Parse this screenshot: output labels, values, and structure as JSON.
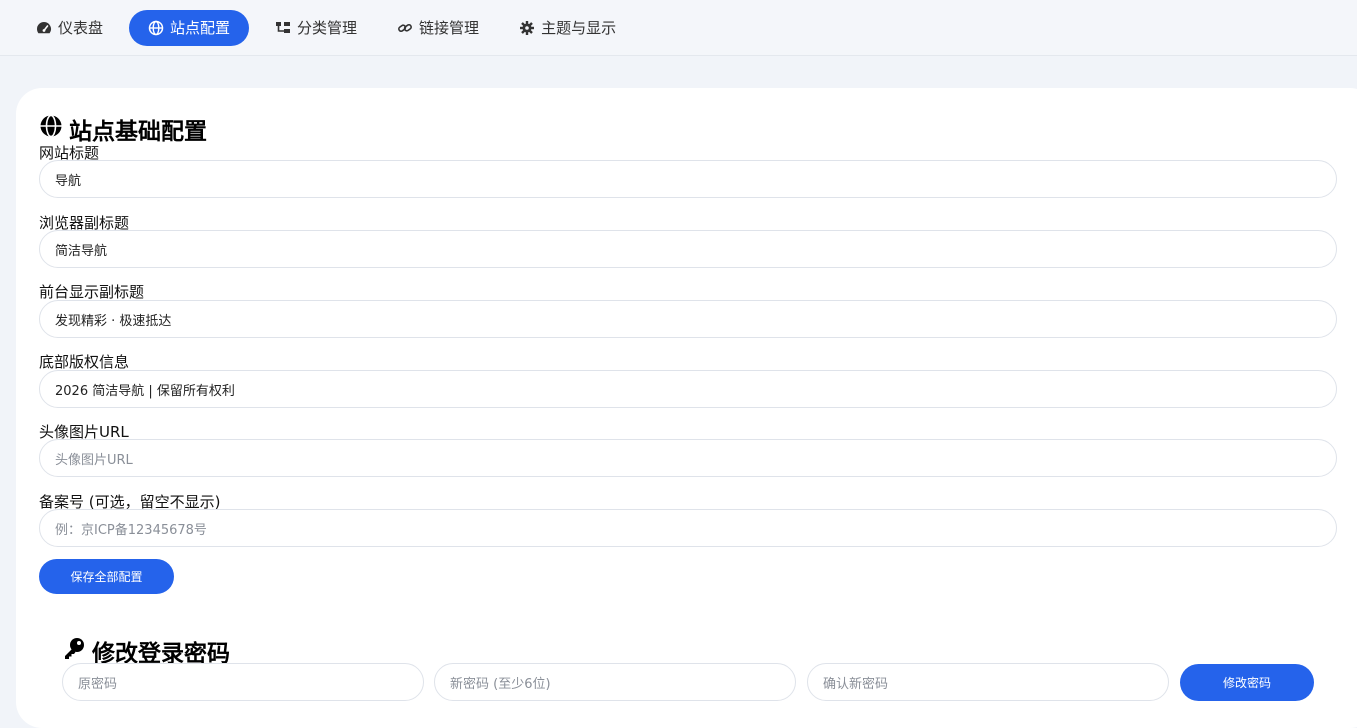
{
  "nav": {
    "tabs": [
      {
        "label": "仪表盘",
        "icon": "gauge-icon"
      },
      {
        "label": "站点配置",
        "icon": "globe-icon",
        "active": true
      },
      {
        "label": "分类管理",
        "icon": "sitemap-icon"
      },
      {
        "label": "链接管理",
        "icon": "link-icon"
      },
      {
        "label": "主题与显示",
        "icon": "gear-icon"
      }
    ]
  },
  "site_config": {
    "title": "站点基础配置",
    "title_icon": "globe-icon",
    "fields": [
      {
        "label": "网站标题",
        "value": "导航",
        "placeholder": ""
      },
      {
        "label": "浏览器副标题",
        "value": "简洁导航",
        "placeholder": ""
      },
      {
        "label": "前台显示副标题",
        "value": "发现精彩 · 极速抵达",
        "placeholder": ""
      },
      {
        "label": "底部版权信息",
        "value": "2026 简洁导航 | 保留所有权利",
        "placeholder": ""
      },
      {
        "label": "头像图片URL",
        "value": "",
        "placeholder": "头像图片URL"
      },
      {
        "label": "备案号 (可选，留空不显示)",
        "value": "",
        "placeholder": "例：京ICP备12345678号"
      }
    ],
    "save_label": "保存全部配置"
  },
  "password": {
    "title": "修改登录密码",
    "title_icon": "key-icon",
    "old_placeholder": "原密码",
    "new_placeholder": "新密码 (至少6位)",
    "confirm_placeholder": "确认新密码",
    "submit_label": "修改密码"
  },
  "colors": {
    "accent": "#2563eb",
    "background": "#f1f4f9",
    "card": "#ffffff"
  }
}
